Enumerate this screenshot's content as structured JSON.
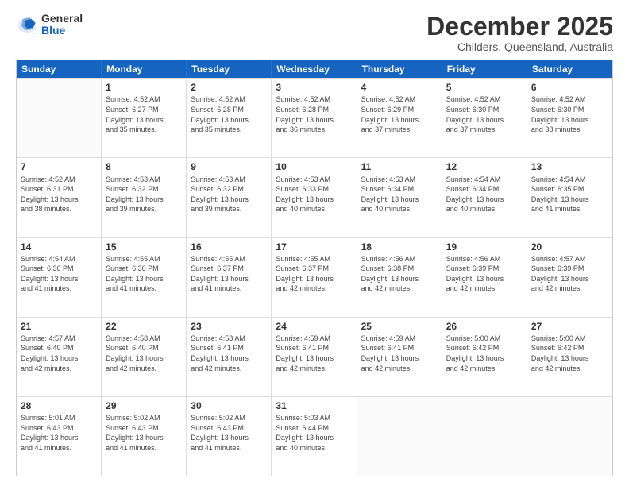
{
  "logo": {
    "general": "General",
    "blue": "Blue"
  },
  "header": {
    "month": "December 2025",
    "location": "Childers, Queensland, Australia"
  },
  "days": [
    "Sunday",
    "Monday",
    "Tuesday",
    "Wednesday",
    "Thursday",
    "Friday",
    "Saturday"
  ],
  "rows": [
    [
      {
        "day": "",
        "info": ""
      },
      {
        "day": "1",
        "info": "Sunrise: 4:52 AM\nSunset: 6:27 PM\nDaylight: 13 hours\nand 35 minutes."
      },
      {
        "day": "2",
        "info": "Sunrise: 4:52 AM\nSunset: 6:28 PM\nDaylight: 13 hours\nand 35 minutes."
      },
      {
        "day": "3",
        "info": "Sunrise: 4:52 AM\nSunset: 6:28 PM\nDaylight: 13 hours\nand 36 minutes."
      },
      {
        "day": "4",
        "info": "Sunrise: 4:52 AM\nSunset: 6:29 PM\nDaylight: 13 hours\nand 37 minutes."
      },
      {
        "day": "5",
        "info": "Sunrise: 4:52 AM\nSunset: 6:30 PM\nDaylight: 13 hours\nand 37 minutes."
      },
      {
        "day": "6",
        "info": "Sunrise: 4:52 AM\nSunset: 6:30 PM\nDaylight: 13 hours\nand 38 minutes."
      }
    ],
    [
      {
        "day": "7",
        "info": "Sunrise: 4:52 AM\nSunset: 6:31 PM\nDaylight: 13 hours\nand 38 minutes."
      },
      {
        "day": "8",
        "info": "Sunrise: 4:53 AM\nSunset: 6:32 PM\nDaylight: 13 hours\nand 39 minutes."
      },
      {
        "day": "9",
        "info": "Sunrise: 4:53 AM\nSunset: 6:32 PM\nDaylight: 13 hours\nand 39 minutes."
      },
      {
        "day": "10",
        "info": "Sunrise: 4:53 AM\nSunset: 6:33 PM\nDaylight: 13 hours\nand 40 minutes."
      },
      {
        "day": "11",
        "info": "Sunrise: 4:53 AM\nSunset: 6:34 PM\nDaylight: 13 hours\nand 40 minutes."
      },
      {
        "day": "12",
        "info": "Sunrise: 4:54 AM\nSunset: 6:34 PM\nDaylight: 13 hours\nand 40 minutes."
      },
      {
        "day": "13",
        "info": "Sunrise: 4:54 AM\nSunset: 6:35 PM\nDaylight: 13 hours\nand 41 minutes."
      }
    ],
    [
      {
        "day": "14",
        "info": "Sunrise: 4:54 AM\nSunset: 6:36 PM\nDaylight: 13 hours\nand 41 minutes."
      },
      {
        "day": "15",
        "info": "Sunrise: 4:55 AM\nSunset: 6:36 PM\nDaylight: 13 hours\nand 41 minutes."
      },
      {
        "day": "16",
        "info": "Sunrise: 4:55 AM\nSunset: 6:37 PM\nDaylight: 13 hours\nand 41 minutes."
      },
      {
        "day": "17",
        "info": "Sunrise: 4:55 AM\nSunset: 6:37 PM\nDaylight: 13 hours\nand 42 minutes."
      },
      {
        "day": "18",
        "info": "Sunrise: 4:56 AM\nSunset: 6:38 PM\nDaylight: 13 hours\nand 42 minutes."
      },
      {
        "day": "19",
        "info": "Sunrise: 4:56 AM\nSunset: 6:39 PM\nDaylight: 13 hours\nand 42 minutes."
      },
      {
        "day": "20",
        "info": "Sunrise: 4:57 AM\nSunset: 6:39 PM\nDaylight: 13 hours\nand 42 minutes."
      }
    ],
    [
      {
        "day": "21",
        "info": "Sunrise: 4:57 AM\nSunset: 6:40 PM\nDaylight: 13 hours\nand 42 minutes."
      },
      {
        "day": "22",
        "info": "Sunrise: 4:58 AM\nSunset: 6:40 PM\nDaylight: 13 hours\nand 42 minutes."
      },
      {
        "day": "23",
        "info": "Sunrise: 4:58 AM\nSunset: 6:41 PM\nDaylight: 13 hours\nand 42 minutes."
      },
      {
        "day": "24",
        "info": "Sunrise: 4:59 AM\nSunset: 6:41 PM\nDaylight: 13 hours\nand 42 minutes."
      },
      {
        "day": "25",
        "info": "Sunrise: 4:59 AM\nSunset: 6:41 PM\nDaylight: 13 hours\nand 42 minutes."
      },
      {
        "day": "26",
        "info": "Sunrise: 5:00 AM\nSunset: 6:42 PM\nDaylight: 13 hours\nand 42 minutes."
      },
      {
        "day": "27",
        "info": "Sunrise: 5:00 AM\nSunset: 6:42 PM\nDaylight: 13 hours\nand 42 minutes."
      }
    ],
    [
      {
        "day": "28",
        "info": "Sunrise: 5:01 AM\nSunset: 6:43 PM\nDaylight: 13 hours\nand 41 minutes."
      },
      {
        "day": "29",
        "info": "Sunrise: 5:02 AM\nSunset: 6:43 PM\nDaylight: 13 hours\nand 41 minutes."
      },
      {
        "day": "30",
        "info": "Sunrise: 5:02 AM\nSunset: 6:43 PM\nDaylight: 13 hours\nand 41 minutes."
      },
      {
        "day": "31",
        "info": "Sunrise: 5:03 AM\nSunset: 6:44 PM\nDaylight: 13 hours\nand 40 minutes."
      },
      {
        "day": "",
        "info": ""
      },
      {
        "day": "",
        "info": ""
      },
      {
        "day": "",
        "info": ""
      }
    ]
  ]
}
